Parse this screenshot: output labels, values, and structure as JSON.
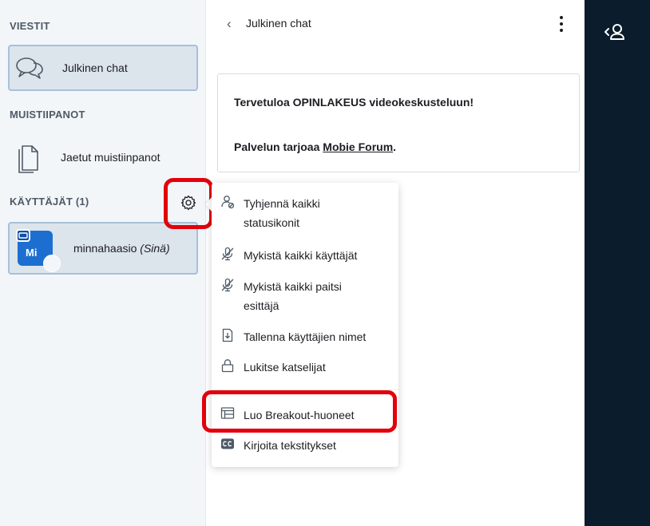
{
  "sidebar": {
    "messages_title": "VIESTIT",
    "public_chat_label": "Julkinen chat",
    "notes_title": "MUISTIIPANOT",
    "shared_notes_label": "Jaetut muistiinpanot",
    "users_title": "KÄYTTÄJÄT (1)",
    "user": {
      "initials": "Mi",
      "name": "minnahaasio",
      "you_label": "(Sinä)"
    }
  },
  "chat": {
    "back_glyph": "‹",
    "title": "Julkinen chat",
    "welcome_line1": "Tervetuloa OPINLAKEUS videokeskusteluun!",
    "welcome_line2_prefix": "Palvelun tarjoaa ",
    "welcome_line2_link": "Mobie Forum",
    "welcome_line2_suffix": "."
  },
  "menu": {
    "items": [
      {
        "icon": "clear-status-icon",
        "label_line1": "Tyhjennä kaikki",
        "label_line2": "statusikonit"
      },
      {
        "icon": "mute-icon",
        "label_line1": "Mykistä kaikki käyttäjät"
      },
      {
        "icon": "mute-icon",
        "label_line1": "Mykistä kaikki paitsi",
        "label_line2": "esittäjä"
      },
      {
        "icon": "download-icon",
        "label_line1": "Tallenna käyttäjien nimet"
      },
      {
        "icon": "lock-icon",
        "label_line1": "Lukitse katselijat"
      },
      {
        "icon": "breakout-icon",
        "label_line1": "Luo Breakout-huoneet"
      },
      {
        "icon": "closed-caption-icon",
        "label_line1": "Kirjoita tekstitykset"
      }
    ]
  },
  "colors": {
    "highlight": "#e3000b",
    "avatar": "#1c6fd1",
    "right_bar": "#0b1c2c",
    "active_item_bg": "#dce4ec"
  }
}
